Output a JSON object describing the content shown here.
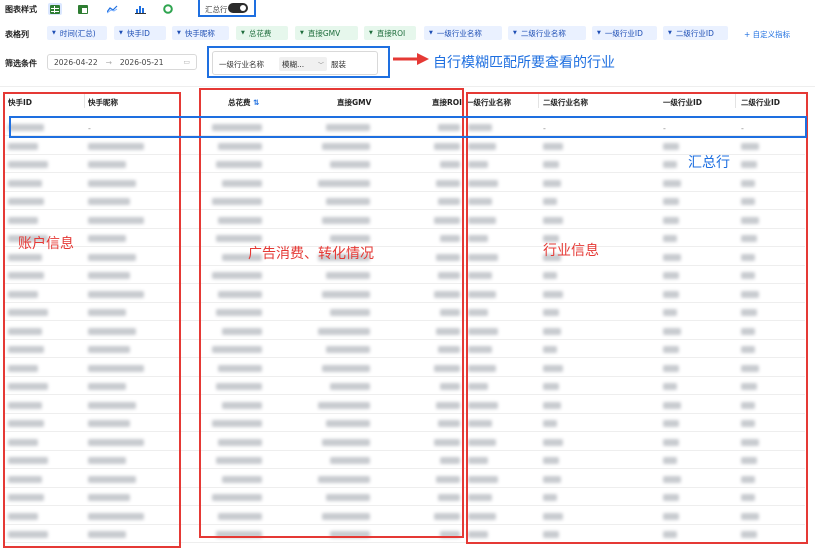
{
  "toolbar": {
    "chart_style_label": "图表样式",
    "summary_toggle_label": "汇总行"
  },
  "columns_row": {
    "label": "表格列",
    "chips": [
      {
        "text": "时间(汇总)",
        "color": "blue"
      },
      {
        "text": "快手ID",
        "color": "blue"
      },
      {
        "text": "快手昵称",
        "color": "blue"
      },
      {
        "text": "总花费",
        "color": "green"
      },
      {
        "text": "直接GMV",
        "color": "green"
      },
      {
        "text": "直接ROI",
        "color": "green"
      },
      {
        "text": "一级行业名称",
        "color": "blue"
      },
      {
        "text": "二级行业名称",
        "color": "blue"
      },
      {
        "text": "一级行业ID",
        "color": "blue"
      },
      {
        "text": "二级行业ID",
        "color": "blue"
      }
    ],
    "custom_metric_label": "+ 自定义指标"
  },
  "filter_row": {
    "label": "筛选条件",
    "date_start": "2026-04-22",
    "date_end": "2026-05-21",
    "field_name": "一级行业名称",
    "match_mode": "模糊...",
    "value": "服装"
  },
  "annotations": {
    "fuzzy_match": "自行模糊匹配所要查看的行业",
    "account_info": "账户信息",
    "ad_spend": "广告消费、转化情况",
    "industry_info": "行业信息",
    "summary_row": "汇总行"
  },
  "table": {
    "headers": [
      "快手ID",
      "快手昵称",
      "总花费",
      "直接GMV",
      "直接ROI",
      "一级行业名称",
      "二级行业名称",
      "一级行业ID",
      "二级行业ID"
    ],
    "sort_icon": "⇅",
    "placeholder": "-"
  },
  "colors": {
    "accent_blue": "#1e6fe0",
    "annotation_red": "#e53935",
    "chip_blue_bg": "#eaf1ff",
    "chip_green_bg": "#e6f7ec"
  }
}
